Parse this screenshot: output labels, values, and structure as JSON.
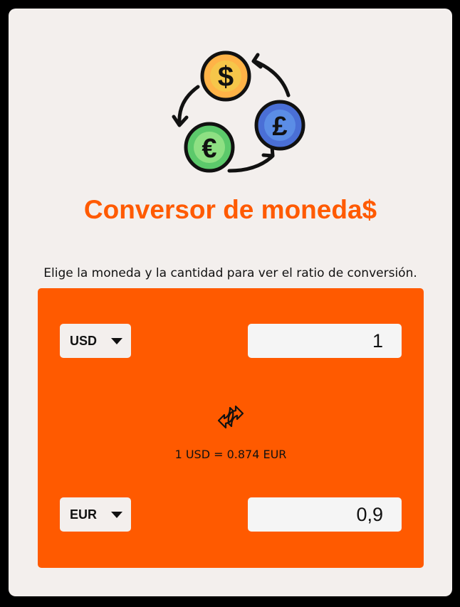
{
  "header": {
    "title": "Conversor de moneda$",
    "subtitle": "Elige la moneda y la cantidad para ver el ratio de conversión."
  },
  "logo": {
    "icons": [
      "dollar-coin-icon",
      "pound-coin-icon",
      "euro-coin-icon",
      "cycle-arrows-icon"
    ]
  },
  "converter": {
    "from": {
      "currency": "USD",
      "amount": "1"
    },
    "to": {
      "currency": "EUR",
      "amount": "0,9"
    },
    "rate_text": "1 USD = 0.874 EUR",
    "swap_icon": "swap-arrows-icon"
  },
  "colors": {
    "accent": "#ff5a00",
    "card_background": "#f3efed",
    "page_background": "#000000"
  }
}
